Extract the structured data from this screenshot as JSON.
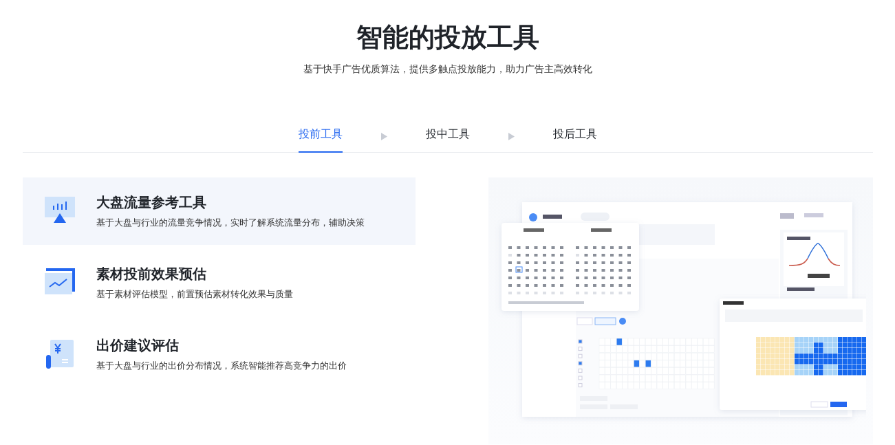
{
  "header": {
    "title": "智能的投放工具",
    "subtitle": "基于快手广告优质算法，提供多触点投放能力，助力广告主高效转化"
  },
  "tabs": [
    {
      "label": "投前工具",
      "selected": true
    },
    {
      "label": "投中工具",
      "selected": false
    },
    {
      "label": "投后工具",
      "selected": false
    }
  ],
  "features": [
    {
      "kind": "traffic",
      "title": "大盘流量参考工具",
      "description": "基于大盘与行业的流量竞争情况，实时了解系统流量分布，辅助决策",
      "selected": true
    },
    {
      "kind": "creative",
      "title": "素材投前效果预估",
      "description": "基于素材评估模型，前置预估素材转化效果与质量",
      "selected": false
    },
    {
      "kind": "bid",
      "title": "出价建议评估",
      "description": "基于大盘与行业的出价分布情况，系统智能推荐高竞争力的出价",
      "selected": false
    }
  ]
}
